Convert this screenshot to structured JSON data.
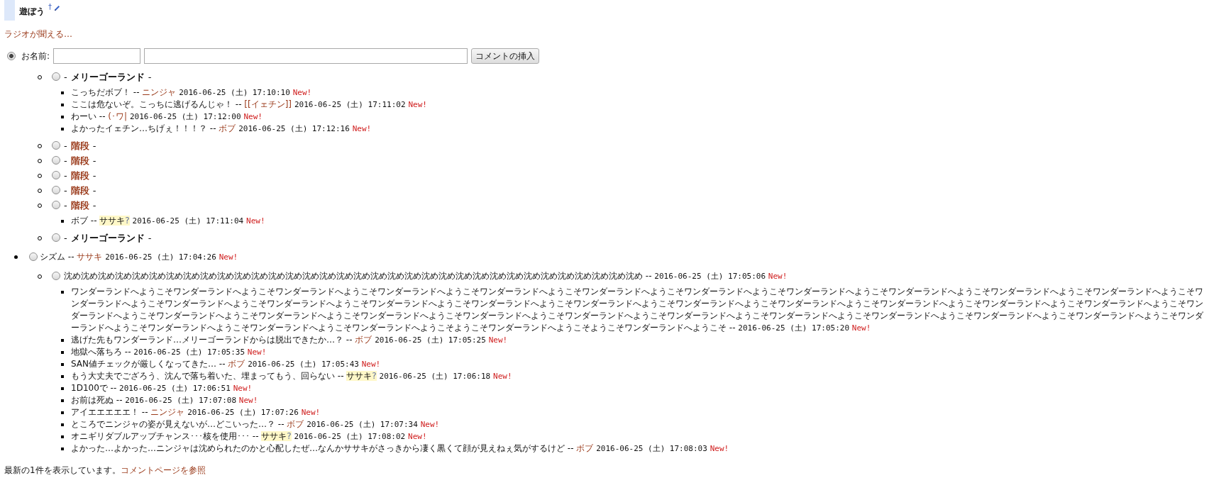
{
  "section": {
    "title": "遊ぼう",
    "anchor": "†"
  },
  "intro_link": "ラジオが聞える…",
  "form": {
    "selected": true,
    "label": "お名前:",
    "button": "コメントの挿入"
  },
  "comments": [
    {
      "kind": "group",
      "children": [
        {
          "kind": "topic",
          "selected": false,
          "lead": "-",
          "title": "メリーゴーランド",
          "tail": "-",
          "linked": false,
          "children": [
            {
              "kind": "comment",
              "text": "こっちだボブ！",
              "sep": "--",
              "author": {
                "kind": "link",
                "name": "ニンジャ"
              },
              "date": "2016-06-25 (土) 17:10:10",
              "badge": "New!"
            },
            {
              "kind": "comment",
              "text": "ここは危ないぞ。こっちに逃げるんじゃ！",
              "sep": "--",
              "author": {
                "kind": "link",
                "name": "[[イェチン]]"
              },
              "date": "2016-06-25 (土) 17:11:02",
              "badge": "New!"
            },
            {
              "kind": "comment",
              "text": "わーい",
              "sep": "--",
              "author": {
                "kind": "link",
                "name": "(･ワ|"
              },
              "date": "2016-06-25 (土) 17:12:00",
              "badge": "New!"
            },
            {
              "kind": "comment",
              "text": "よかったイェチン…ちげぇ！！！？",
              "sep": "--",
              "author": {
                "kind": "link",
                "name": "ボブ"
              },
              "date": "2016-06-25 (土) 17:12:16",
              "badge": "New!"
            }
          ]
        },
        {
          "kind": "topic",
          "selected": false,
          "lead": "-",
          "title": "階段",
          "tail": "-",
          "linked": true
        },
        {
          "kind": "topic",
          "selected": false,
          "lead": "-",
          "title": "階段",
          "tail": "-",
          "linked": true
        },
        {
          "kind": "topic",
          "selected": false,
          "lead": "-",
          "title": "階段",
          "tail": "-",
          "linked": true
        },
        {
          "kind": "topic",
          "selected": false,
          "lead": "-",
          "title": "階段",
          "tail": "-",
          "linked": true
        },
        {
          "kind": "topic",
          "selected": false,
          "lead": "-",
          "title": "階段",
          "tail": "-",
          "linked": true,
          "children": [
            {
              "kind": "comment",
              "text": "ボブ",
              "sep": "--",
              "author": {
                "kind": "missing",
                "name": "ササキ",
                "mark": "?"
              },
              "date": "2016-06-25 (土) 17:11:04",
              "badge": "New!"
            }
          ]
        },
        {
          "kind": "topic",
          "selected": false,
          "lead": "-",
          "title": "メリーゴーランド",
          "tail": "-",
          "linked": false
        }
      ]
    },
    {
      "kind": "comment",
      "selected": false,
      "text": "シズム",
      "sep": "--",
      "author": {
        "kind": "link",
        "name": "ササキ"
      },
      "date": "2016-06-25 (土) 17:04:26",
      "badge": "New!",
      "children": [
        {
          "kind": "comment",
          "selected": false,
          "text": "沈め沈め沈め沈め沈め沈め沈め沈め沈め沈め沈め沈め沈め沈め沈め沈め沈め沈め沈め沈め沈め沈め沈め沈め沈め沈め沈め沈め沈め沈め沈め沈め沈め沈め",
          "sep": "--",
          "date": "2016-06-25 (土) 17:05:06",
          "badge": "New!",
          "children": [
            {
              "kind": "comment",
              "text": "ワンダーランドへようこそワンダーランドへようこそワンダーランドへようこそワンダーランドへようこそワンダーランドへようこそワンダーランドへようこそワンダーランドへようこそワンダーランドへようこそワンダーランドへようこそワンダーランドへようこそワンダーランドへようこそワンダーランドへようこそワンダーランドへようこそワンダーランドへようこそワンダーランドへようこそワンダーランドへようこそワンダーランドへようこそワンダーランドへようこそワンダーランドへようこそワンダーランドへようこそワンダーランドへようこそワンダーランドへようこそワンダーランドへようこそワンダーランドへようこそワンダーランドへようこそワンダーランドへようこそワンダーランドへようこそワンダーランドへようこそワンダーランドへようこそワンダーランドへようこそワンダーランドへようこそワンダーランドへようこそワンダーランドへようこそワンダーランドへようこそワンダーランドへようこそワンダーランドへようこそワンダーランドへようこそようこそワンダーランドへようこそようこそワンダーランドへようこそ",
              "sep": "--",
              "date": "2016-06-25 (土) 17:05:20",
              "badge": "New!"
            },
            {
              "kind": "comment",
              "text": "逃げた先もワンダーランド…メリーゴーランドからは脱出できたか…？",
              "sep": "--",
              "author": {
                "kind": "link",
                "name": "ボブ"
              },
              "date": "2016-06-25 (土) 17:05:25",
              "badge": "New!"
            },
            {
              "kind": "comment",
              "text": "地獄へ落ちろ",
              "sep": "--",
              "date": "2016-06-25 (土) 17:05:35",
              "badge": "New!"
            },
            {
              "kind": "comment",
              "text": "SAN値チェックが厳しくなってきた…",
              "sep": "--",
              "author": {
                "kind": "link",
                "name": "ボブ"
              },
              "date": "2016-06-25 (土) 17:05:43",
              "badge": "New!"
            },
            {
              "kind": "comment",
              "text": "もう大丈夫でござろう、沈んで落ち着いた、埋まってもう、回らない",
              "sep": "--",
              "author": {
                "kind": "missing",
                "name": "ササキ",
                "mark": "?"
              },
              "date": "2016-06-25 (土) 17:06:18",
              "badge": "New!"
            },
            {
              "kind": "comment",
              "text": "1D100で",
              "sep": "--",
              "date": "2016-06-25 (土) 17:06:51",
              "badge": "New!"
            },
            {
              "kind": "comment",
              "text": "お前は死ぬ",
              "sep": "--",
              "date": "2016-06-25 (土) 17:07:08",
              "badge": "New!"
            },
            {
              "kind": "comment",
              "text": "アイエエエエエ！",
              "sep": "--",
              "author": {
                "kind": "link",
                "name": "ニンジャ"
              },
              "date": "2016-06-25 (土) 17:07:26",
              "badge": "New!"
            },
            {
              "kind": "comment",
              "text": "ところでニンジャの姿が見えないが…どこいった…？",
              "sep": "--",
              "author": {
                "kind": "link",
                "name": "ボブ"
              },
              "date": "2016-06-25 (土) 17:07:34",
              "badge": "New!"
            },
            {
              "kind": "comment",
              "text": "オニギリダブルアップチャンス･･･核を使用･･･",
              "sep": "--",
              "author": {
                "kind": "missing",
                "name": "ササキ",
                "mark": "?"
              },
              "date": "2016-06-25 (土) 17:08:02",
              "badge": "New!"
            },
            {
              "kind": "comment",
              "text": "よかった…よかった…ニンジャは沈められたのかと心配したぜ…なんかササキがさっきから凄く黒くて顔が見えねぇ気がするけど",
              "sep": "--",
              "author": {
                "kind": "link",
                "name": "ボブ"
              },
              "date": "2016-06-25 (土) 17:08:03",
              "badge": "New!"
            }
          ]
        }
      ]
    }
  ],
  "footer": {
    "text": "最新の1件を表示しています。",
    "link": "コメントページを参照"
  }
}
